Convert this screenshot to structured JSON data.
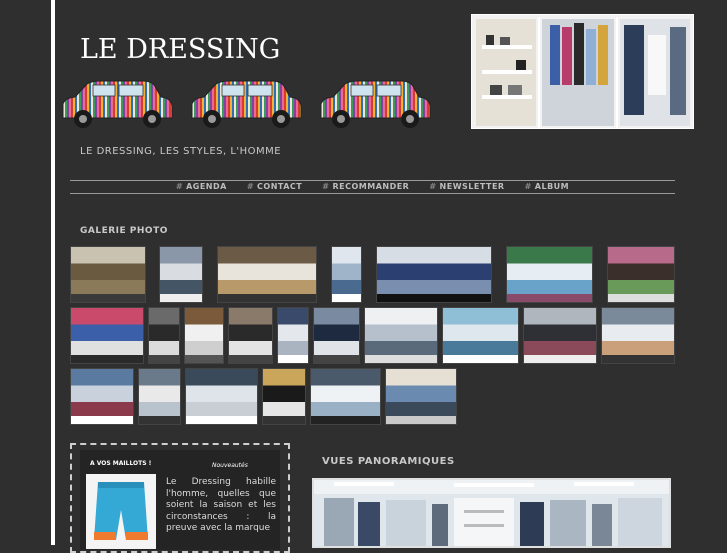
{
  "site": {
    "title": "LE DRESSING",
    "tagline": "LE DRESSING, LES STYLES, L'HOMME"
  },
  "nav": {
    "items": [
      {
        "label": "AGENDA"
      },
      {
        "label": "CONTACT"
      },
      {
        "label": "RECOMMANDER"
      },
      {
        "label": "NEWSLETTER"
      },
      {
        "label": "ALBUM"
      }
    ],
    "separator": "#"
  },
  "gallery": {
    "title": "GALERIE PHOTO",
    "photo_count": 26
  },
  "news": {
    "headline": "A VOS MAILLOTS !",
    "category": "Nouveautés",
    "text": "Le Dressing habille l'homme, quelles que soient la saison et les circonstances : la preuve avec la marque"
  },
  "panorama": {
    "title": "VUES PANORAMIQUES"
  },
  "colors": {
    "background": "#2f2f2f",
    "text": "#c9c9c9",
    "accent": "#ffffff"
  }
}
